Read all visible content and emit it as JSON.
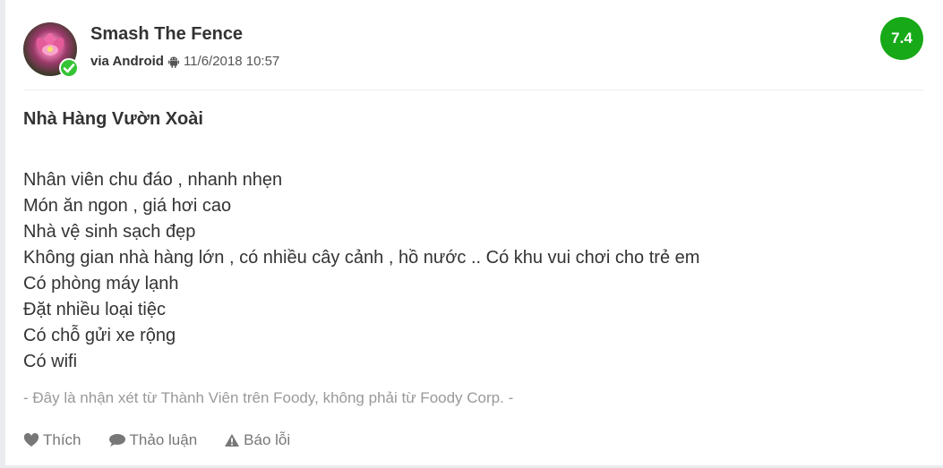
{
  "review": {
    "user_name": "Smash The Fence",
    "via": "via Android",
    "timestamp": "11/6/2018 10:57",
    "score": "7.4",
    "title": "Nhà Hàng Vườn Xoài",
    "lines": [
      "Nhân viên chu đáo , nhanh nhẹn",
      "Món ăn ngon , giá hơi cao",
      "Nhà vệ sinh sạch đẹp",
      "Không gian nhà hàng lớn , có nhiều cây cảnh , hồ nước .. Có khu vui chơi cho trẻ em",
      "Có phòng máy lạnh",
      "Đặt nhiều loại tiệc",
      "Có chỗ gửi xe rộng",
      "Có wifi"
    ],
    "disclaimer": "- Đây là nhận xét từ Thành Viên trên Foody, không phải từ Foody Corp. -"
  },
  "actions": {
    "like_label": "Thích",
    "discuss_label": "Thảo luận",
    "report_label": "Báo lỗi"
  },
  "colors": {
    "score_bg": "#17a917",
    "verified": "#35c435"
  },
  "icons": {
    "android": "android-icon",
    "verified": "check-icon",
    "like": "heart-icon",
    "discuss": "comment-icon",
    "report": "warning-icon"
  }
}
